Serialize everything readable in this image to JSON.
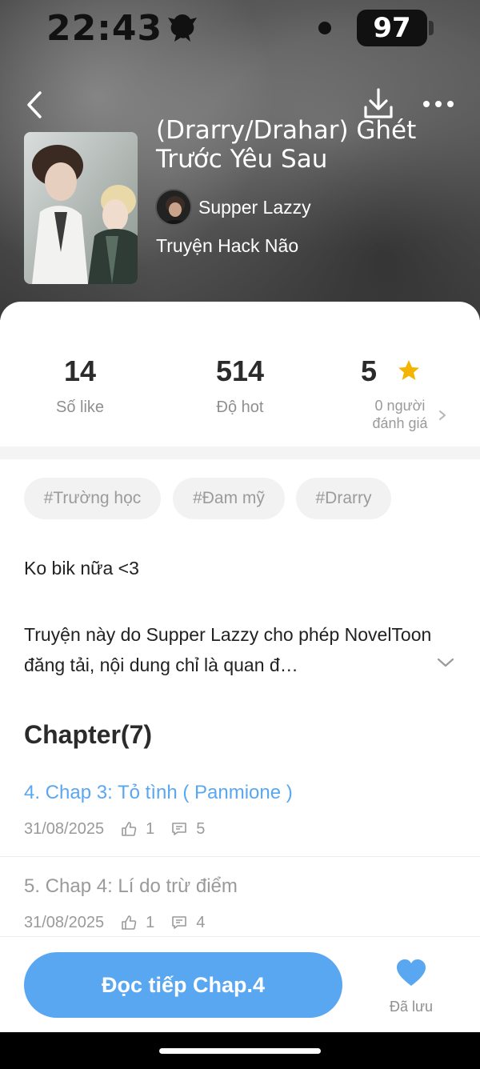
{
  "status_bar": {
    "time": "22:43",
    "battery": "97"
  },
  "book": {
    "title": "(Drarry/Drahar) Ghét Trước Yêu Sau",
    "author": "Supper Lazzy",
    "genre": "Truyện Hack Não"
  },
  "stats": {
    "likes": {
      "value": "14",
      "label": "Số like"
    },
    "hot": {
      "value": "514",
      "label": "Độ hot"
    },
    "rating": {
      "value": "5",
      "label_line1": "0 người",
      "label_line2": "đánh giá"
    }
  },
  "tags": [
    "#Trường học",
    "#Đam mỹ",
    "#Drarry"
  ],
  "description": {
    "line1": "Ko bik nữa <3",
    "line2": "Truyện này do Supper Lazzy cho phép NovelToon đăng tải, nội dung chỉ là quan đ…"
  },
  "chapters_heading": "Chapter(7)",
  "chapters": [
    {
      "title": "4. Chap 3: Tỏ tình ( Panmione )",
      "date": "31/08/2025",
      "likes": "1",
      "comments": "5",
      "current": true
    },
    {
      "title": "5. Chap 4: Lí do trừ điểm",
      "date": "31/08/2025",
      "likes": "1",
      "comments": "4",
      "current": false
    }
  ],
  "actions": {
    "read_label": "Đọc tiếp Chap.4",
    "saved_label": "Đã lưu"
  },
  "colors": {
    "accent": "#5aa7f1",
    "star": "#f5b400",
    "current_chapter": "#5aa7f1"
  }
}
